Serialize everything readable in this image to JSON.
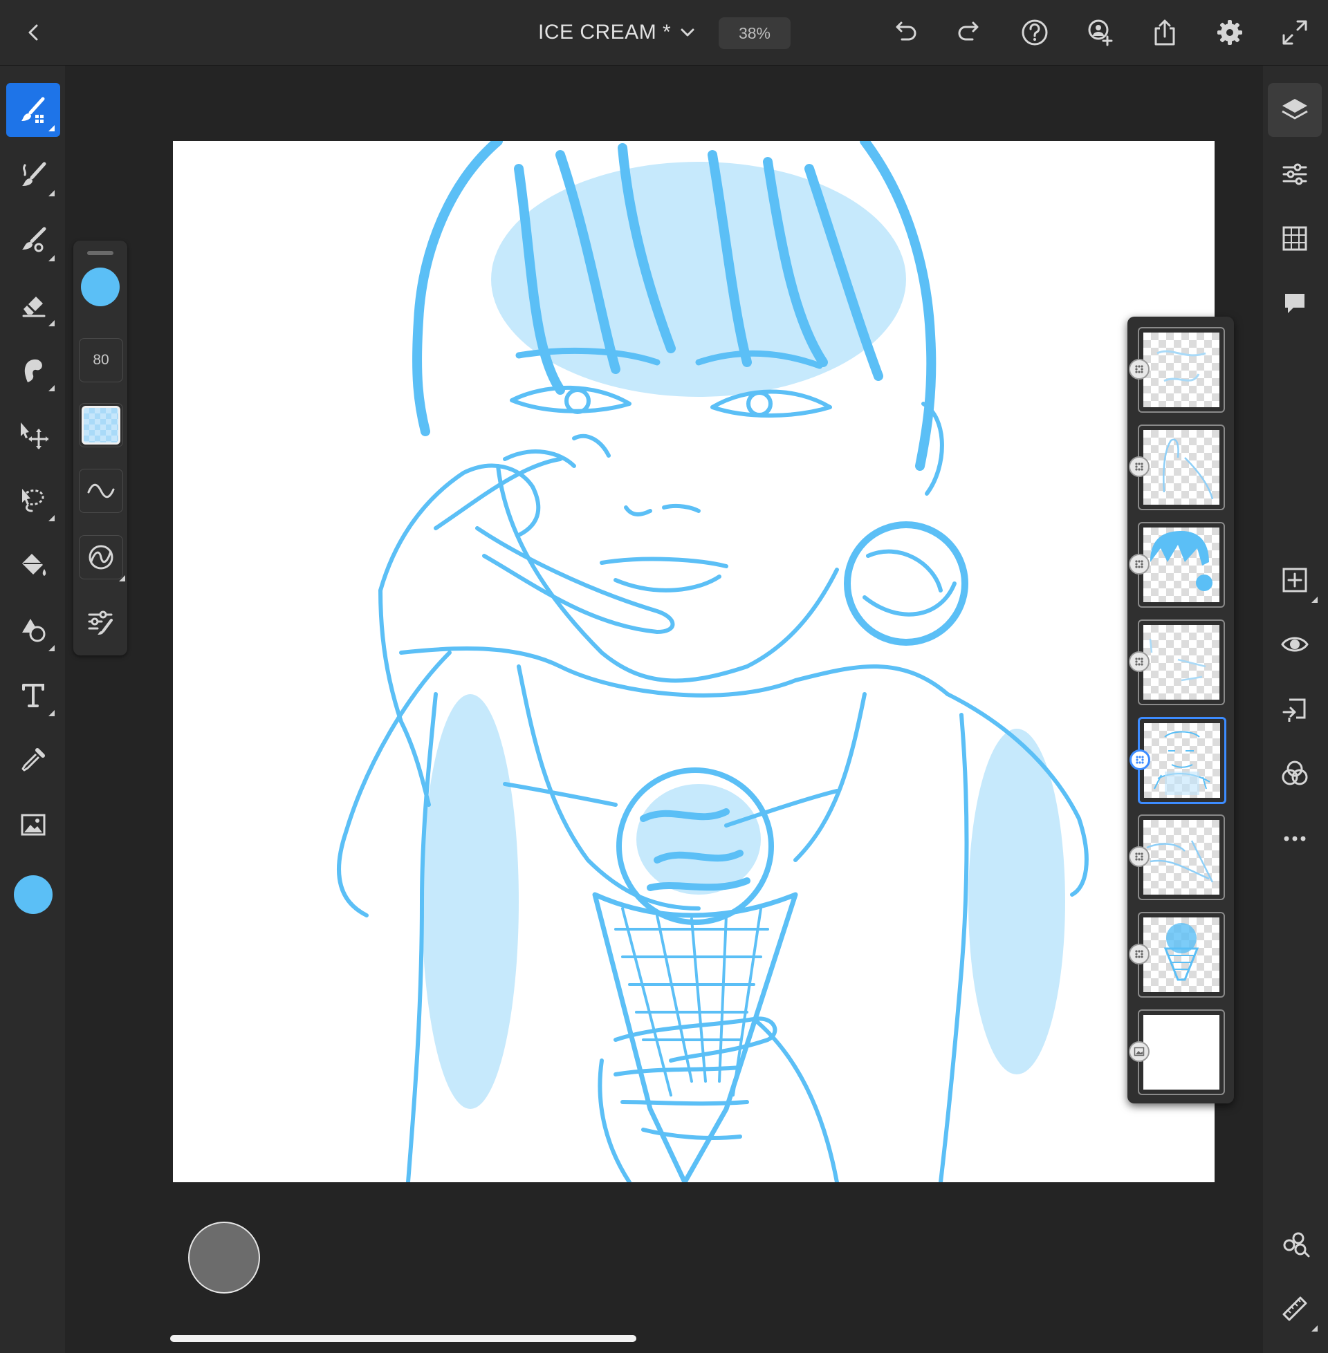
{
  "app": {
    "document_title": "ICE CREAM *",
    "zoom_level": "38%"
  },
  "brush_properties": {
    "size_value": "80",
    "color": "#5bbff6"
  },
  "current_color": "#5bbff6",
  "colors": {
    "accent": "#1e74e8",
    "background": "#242424",
    "toolbar": "#2b2b2b",
    "sketch_blue": "#5bbff6"
  },
  "layers": {
    "count": 8,
    "active_index": 4
  },
  "icons": {
    "top": [
      "back-icon",
      "chevron-down-icon",
      "undo-icon",
      "redo-icon",
      "help-icon",
      "invite-icon",
      "share-icon",
      "settings-icon",
      "fullscreen-icon"
    ],
    "left": [
      "pixel-brush-icon",
      "live-brush-icon",
      "vector-brush-icon",
      "eraser-icon",
      "smudge-icon",
      "transform-icon",
      "lasso-icon",
      "fill-icon",
      "shapes-icon",
      "text-icon",
      "eyedropper-icon",
      "image-icon"
    ],
    "right": [
      "layers-icon",
      "layer-properties-icon",
      "grid-icon",
      "comments-icon",
      "add-layer-icon",
      "visibility-icon",
      "merge-icon",
      "blend-icon",
      "more-icon",
      "livestream-icon",
      "ruler-icon"
    ]
  }
}
